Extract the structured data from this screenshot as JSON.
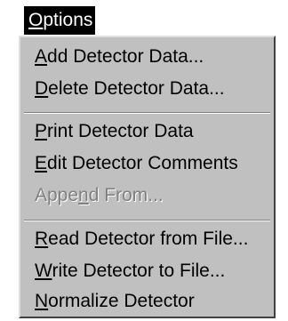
{
  "menubar": {
    "title": "Options",
    "mnemonic": "O",
    "rest": "ptions"
  },
  "menu": {
    "items": [
      {
        "label": "Add Detector Data...",
        "mnemonic": "A",
        "rest": "dd Detector Data...",
        "enabled": true
      },
      {
        "label": "Delete Detector Data...",
        "mnemonic": "D",
        "rest": "elete Detector Data...",
        "enabled": true
      },
      {
        "label": "Print Detector Data",
        "mnemonic": "P",
        "rest": "rint Detector Data",
        "enabled": true
      },
      {
        "label": "Edit Detector Comments",
        "mnemonic": "E",
        "rest": "dit Detector Comments",
        "enabled": true
      },
      {
        "label": "Append From...",
        "pre": "Appe",
        "mnemonic": "n",
        "rest": "d From...",
        "enabled": false
      },
      {
        "label": "Read Detector from File...",
        "mnemonic": "R",
        "rest": "ead Detector from File...",
        "enabled": true
      },
      {
        "label": "Write Detector to File...",
        "mnemonic": "W",
        "rest": "rite Detector to File...",
        "enabled": true
      },
      {
        "label": "Normalize Detector",
        "mnemonic": "N",
        "rest": "ormalize Detector",
        "enabled": true
      }
    ]
  },
  "colors": {
    "menu_bg": "#c0c0c0",
    "title_bg": "#000000",
    "title_fg": "#ffffff",
    "disabled_fg": "#808080"
  }
}
